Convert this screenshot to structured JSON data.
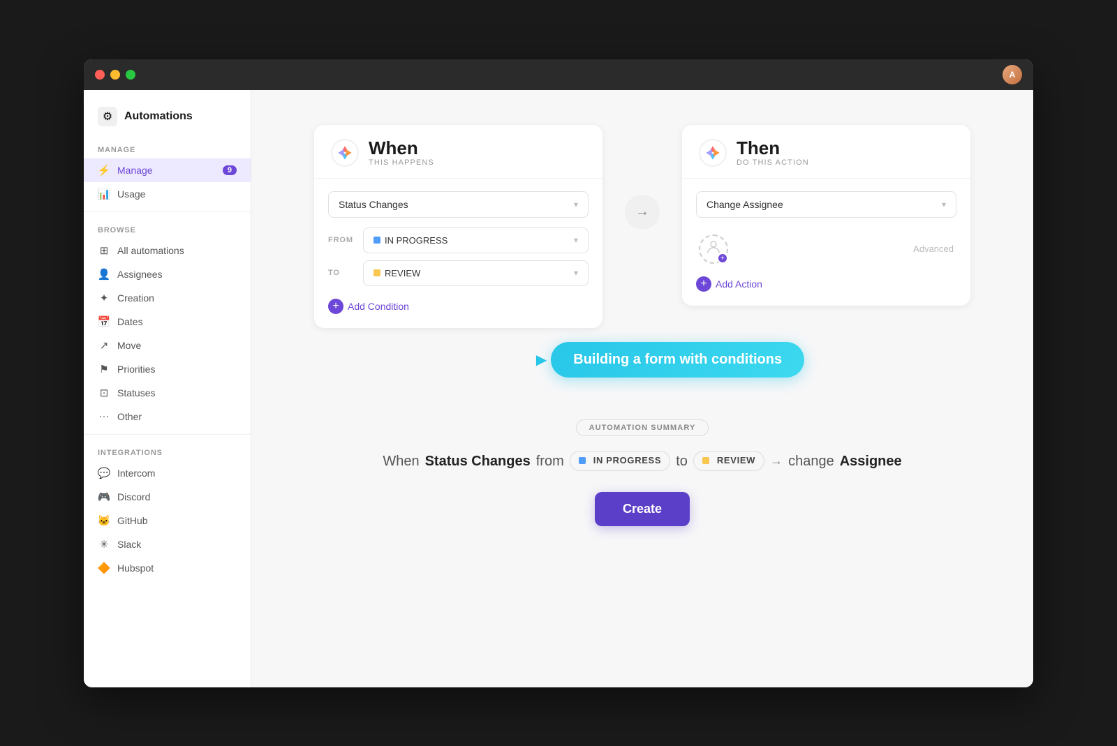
{
  "window": {
    "title": "Automations"
  },
  "titlebar": {
    "avatar_initial": "A"
  },
  "sidebar": {
    "title": "Automations",
    "sections": [
      {
        "label": "MANAGE",
        "items": [
          {
            "id": "manage",
            "label": "Manage",
            "icon": "⚡",
            "active": true,
            "badge": "9"
          },
          {
            "id": "usage",
            "label": "Usage",
            "icon": "📊",
            "active": false,
            "badge": ""
          }
        ]
      },
      {
        "label": "BROWSE",
        "items": [
          {
            "id": "all-automations",
            "label": "All automations",
            "icon": "⊞",
            "active": false,
            "badge": ""
          },
          {
            "id": "assignees",
            "label": "Assignees",
            "icon": "👤",
            "active": false,
            "badge": ""
          },
          {
            "id": "creation",
            "label": "Creation",
            "icon": "✦",
            "active": false,
            "badge": ""
          },
          {
            "id": "dates",
            "label": "Dates",
            "icon": "📅",
            "active": false,
            "badge": ""
          },
          {
            "id": "move",
            "label": "Move",
            "icon": "↗",
            "active": false,
            "badge": ""
          },
          {
            "id": "priorities",
            "label": "Priorities",
            "icon": "⚑",
            "active": false,
            "badge": ""
          },
          {
            "id": "statuses",
            "label": "Statuses",
            "icon": "⊡",
            "active": false,
            "badge": ""
          },
          {
            "id": "other",
            "label": "Other",
            "icon": "···",
            "active": false,
            "badge": ""
          }
        ]
      },
      {
        "label": "INTEGRATIONS",
        "items": [
          {
            "id": "intercom",
            "label": "Intercom",
            "icon": "💬",
            "active": false,
            "badge": ""
          },
          {
            "id": "discord",
            "label": "Discord",
            "icon": "🎮",
            "active": false,
            "badge": ""
          },
          {
            "id": "github",
            "label": "GitHub",
            "icon": "🐱",
            "active": false,
            "badge": ""
          },
          {
            "id": "slack",
            "label": "Slack",
            "icon": "✳",
            "active": false,
            "badge": ""
          },
          {
            "id": "hubspot",
            "label": "Hubspot",
            "icon": "🔶",
            "active": false,
            "badge": ""
          }
        ]
      }
    ]
  },
  "when_card": {
    "title": "When",
    "subtitle": "THIS HAPPENS",
    "trigger_value": "Status Changes",
    "from_label": "FROM",
    "from_value": "IN PROGRESS",
    "from_dot": "blue",
    "to_label": "TO",
    "to_value": "REVIEW",
    "to_dot": "yellow",
    "add_condition_label": "Add Condition"
  },
  "then_card": {
    "title": "Then",
    "subtitle": "DO THIS ACTION",
    "action_value": "Change Assignee",
    "advanced_label": "Advanced",
    "add_action_label": "Add Action"
  },
  "tooltip": {
    "text": "Building a form with conditions"
  },
  "summary": {
    "section_label": "AUTOMATION SUMMARY",
    "when_text": "When",
    "status_changes_text": "Status Changes",
    "from_text": "from",
    "in_progress_badge": "IN PROGRESS",
    "to_text": "to",
    "review_badge": "REVIEW",
    "change_text": "change",
    "assignee_text": "Assignee"
  },
  "create_button": {
    "label": "Create"
  }
}
